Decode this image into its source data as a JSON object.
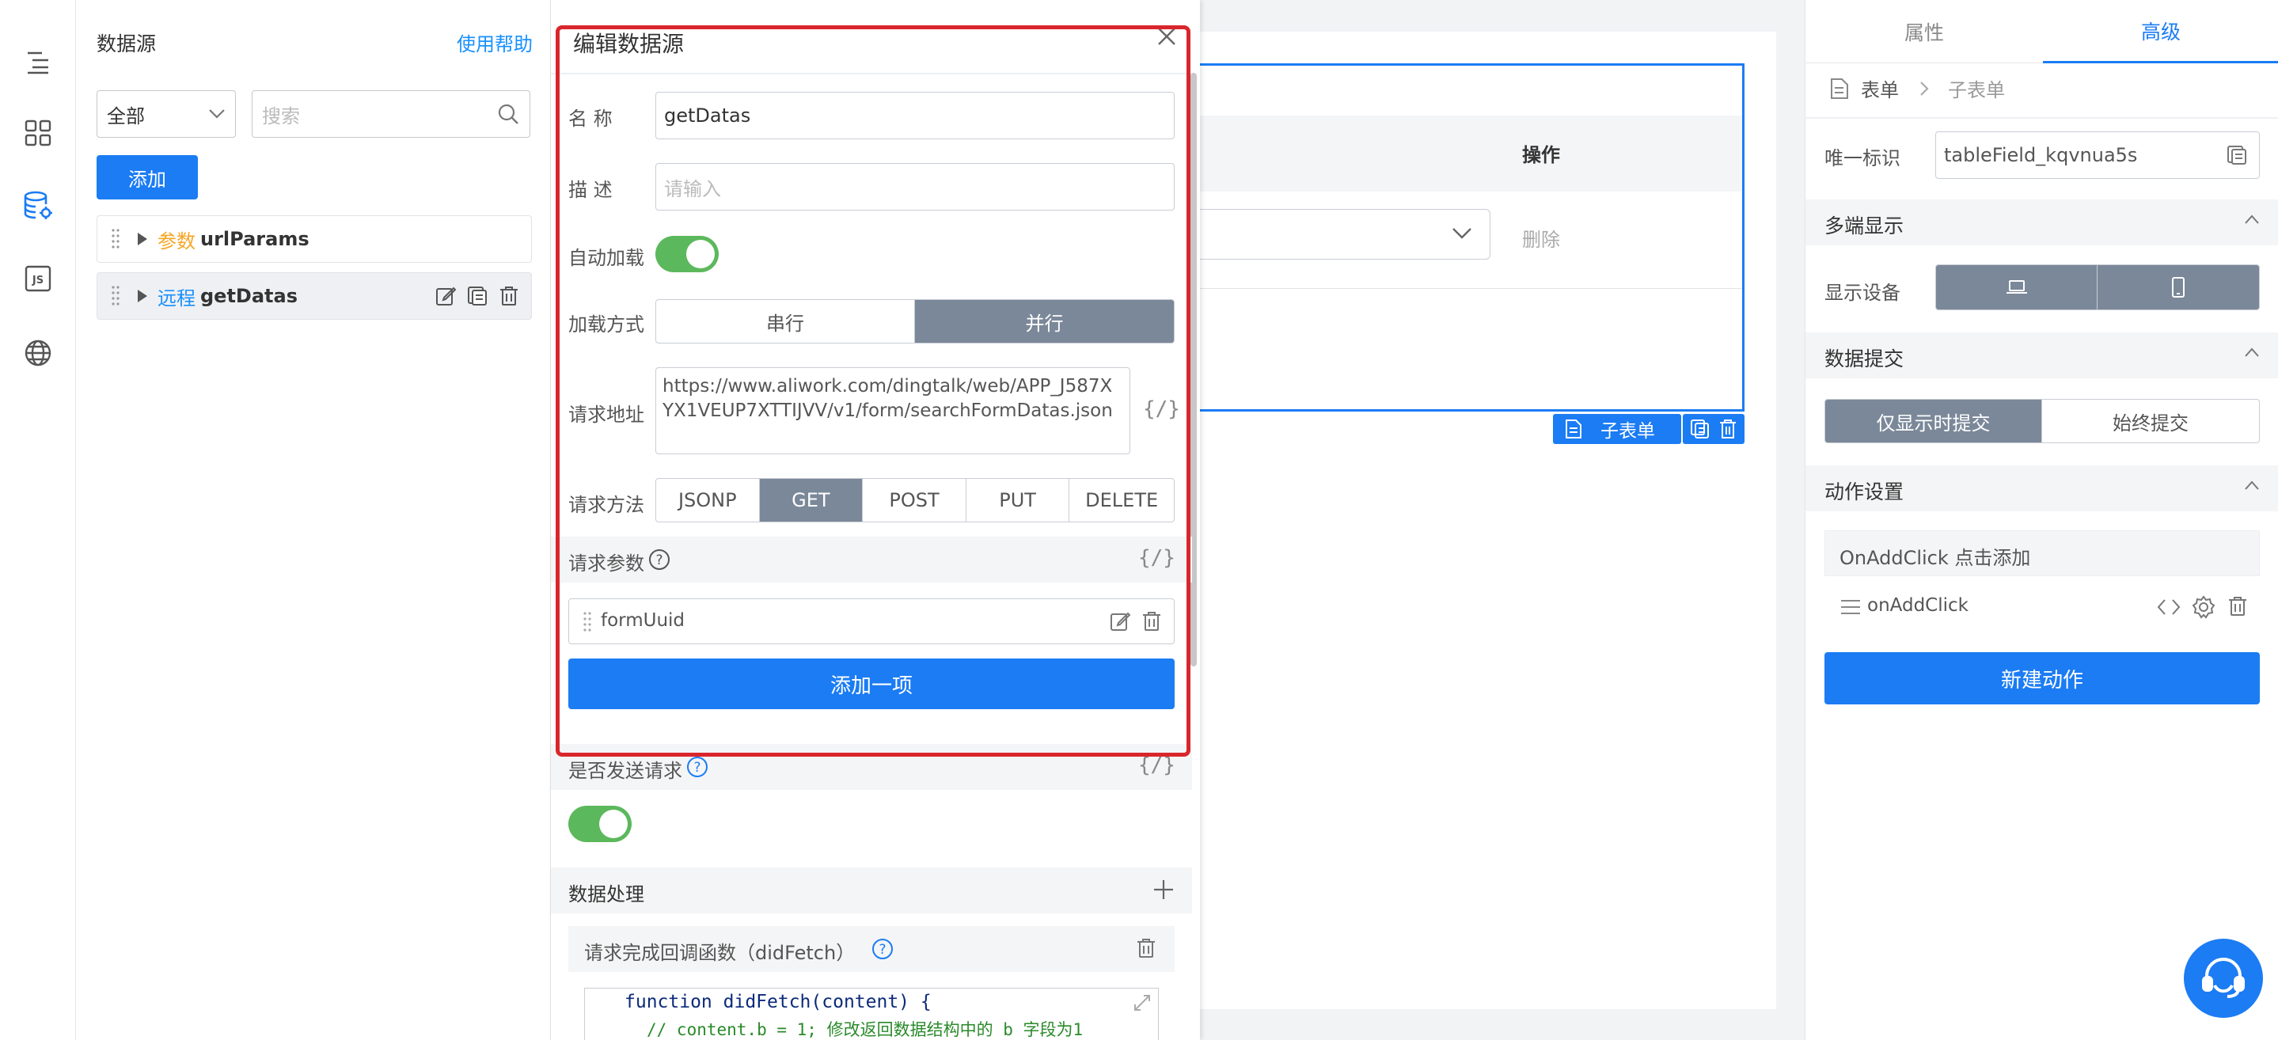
{
  "left_panel": {
    "title": "数据源",
    "help_link": "使用帮助",
    "filter_value": "全部",
    "search_placeholder": "搜索",
    "add_button": "添加",
    "items": [
      {
        "tag": "参数",
        "name": "urlParams",
        "tag_color": "#f5a623"
      },
      {
        "tag": "远程",
        "name": "getDatas",
        "tag_color": "#1890ff"
      }
    ]
  },
  "edit_panel": {
    "title": "编辑数据源",
    "name_label": "名 称",
    "name_value": "getDatas",
    "desc_label": "描 述",
    "desc_placeholder": "请输入",
    "autoload_label": "自动加载",
    "autoload_on": true,
    "load_mode_label": "加载方式",
    "load_modes": [
      "串行",
      "并行"
    ],
    "load_mode_selected": "并行",
    "url_label": "请求地址",
    "url_value": "https://www.aliwork.com/dingtalk/web/APP_J587XYX1VEUP7XTTIJVV/v1/form/searchFormDatas.json",
    "method_label": "请求方法",
    "methods": [
      "JSONP",
      "GET",
      "POST",
      "PUT",
      "DELETE"
    ],
    "method_selected": "GET",
    "params_label": "请求参数",
    "param_items": [
      "formUuid"
    ],
    "add_item_button": "添加一项",
    "send_request_label": "是否发送请求",
    "send_request_on": true,
    "data_process_label": "数据处理",
    "callback_label": "请求完成回调函数（didFetch）",
    "code_line1": "function didFetch(content) {",
    "code_line2": "// content.b = 1; 修改返回数据结构中的 b 字段为1"
  },
  "canvas": {
    "column_header": "操作",
    "delete_link": "删除",
    "subform_tag": "子表单"
  },
  "right_panel": {
    "tabs": [
      "属性",
      "高级"
    ],
    "active_tab": "高级",
    "breadcrumb_root": "表单",
    "breadcrumb_child": "子表单",
    "id_label": "唯一标识",
    "id_value": "tableField_kqvnua5s",
    "multi_display_title": "多端显示",
    "device_label": "显示设备",
    "submit_title": "数据提交",
    "submit_options": [
      "仅显示时提交",
      "始终提交"
    ],
    "submit_selected": "仅显示时提交",
    "action_title": "动作设置",
    "action_event": "OnAddClick 点击添加",
    "action_name": "onAddClick",
    "new_action_button": "新建动作"
  },
  "colors": {
    "primary": "#1b7cf4",
    "highlight_border": "#d9262c",
    "toggle_on": "#5cb85c",
    "segment_selected": "#7b8899"
  }
}
